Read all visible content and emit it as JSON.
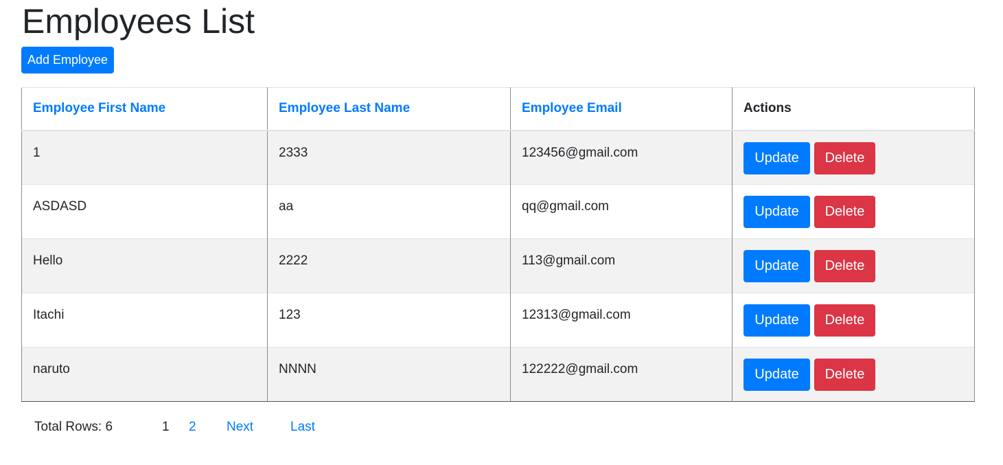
{
  "page": {
    "title": "Employees List",
    "add_button_label": "Add Employee"
  },
  "table": {
    "columns": [
      {
        "label": "Employee First Name"
      },
      {
        "label": "Employee Last Name"
      },
      {
        "label": "Employee Email"
      },
      {
        "label": "Actions"
      }
    ],
    "rows": [
      {
        "first_name": "1",
        "last_name": "2333",
        "email": "123456@gmail.com"
      },
      {
        "first_name": "ASDASD",
        "last_name": "aa",
        "email": "qq@gmail.com"
      },
      {
        "first_name": "Hello",
        "last_name": "2222",
        "email": "113@gmail.com"
      },
      {
        "first_name": "Itachi",
        "last_name": "123",
        "email": "12313@gmail.com"
      },
      {
        "first_name": "naruto",
        "last_name": "NNNN",
        "email": "122222@gmail.com"
      }
    ],
    "update_label": "Update",
    "delete_label": "Delete"
  },
  "pagination": {
    "total_text": "Total Rows: 6",
    "current_page": "1",
    "pages": [
      "1",
      "2"
    ],
    "next_label": "Next",
    "last_label": "Last"
  },
  "colors": {
    "primary": "#007bff",
    "danger": "#dc3545",
    "striped_row": "#f2f2f2",
    "text": "#212529"
  }
}
